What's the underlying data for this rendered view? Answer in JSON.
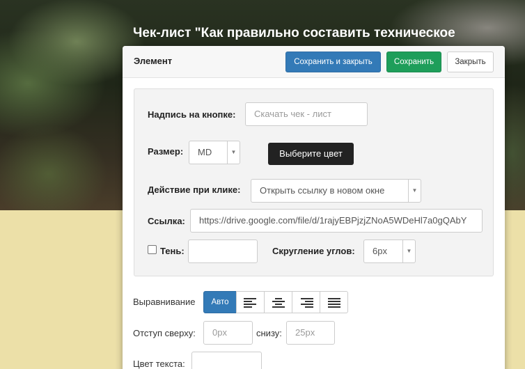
{
  "page": {
    "title": "Чек-лист \"Как правильно составить техническое"
  },
  "modal": {
    "title": "Элемент",
    "save_close_label": "Сохранить и закрыть",
    "save_label": "Сохранить",
    "close_label": "Закрыть"
  },
  "form": {
    "button_text_label": "Надпись на кнопке:",
    "button_text_placeholder": "Скачать чек - лист",
    "size_label": "Размер:",
    "size_value": "MD",
    "color_button_label": "Выберите цвет",
    "action_label": "Действие при клике:",
    "action_value": "Открыть ссылку в новом окне",
    "link_label": "Ссылка:",
    "link_value": "https://drive.google.com/file/d/1rajyEBPjzjZNoA5WDeHl7a0gQAbY",
    "shadow_label": "Тень:",
    "shadow_checked": false,
    "radius_label": "Скругление углов:",
    "radius_value": "6px"
  },
  "alignment": {
    "label": "Выравнивание",
    "auto_label": "Авто",
    "options": [
      "align-left-icon",
      "align-center-icon",
      "align-right-icon",
      "align-justify-icon"
    ],
    "active": "auto"
  },
  "margins": {
    "top_label": "Отступ сверху:",
    "top_placeholder": "0px",
    "bottom_label": "снизу:",
    "bottom_placeholder": "25px"
  },
  "text_color": {
    "label": "Цвет текста:"
  },
  "colors": {
    "primary": "#337ab7",
    "success": "#1e9e5a",
    "dark": "#222222",
    "page_bg": "#ece0a8"
  }
}
